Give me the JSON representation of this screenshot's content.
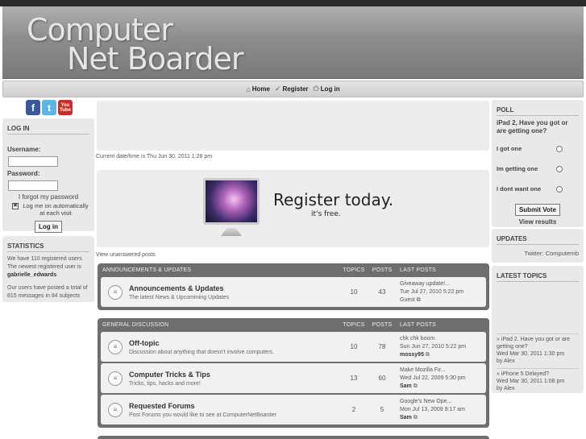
{
  "header": {
    "logo_line1": "Computer",
    "logo_line2": "Net Boarder"
  },
  "nav": {
    "home": "Home",
    "register": "Register",
    "login": "Log in"
  },
  "social": {
    "facebook": "f",
    "twitter": "t",
    "youtube": "You Tube"
  },
  "login_panel": {
    "title": "LOG IN",
    "username_label": "Username:",
    "password_label": "Password:",
    "forgot": "I forgot my password",
    "remember": "Log me on automatically at each visit",
    "remember_check": "✖",
    "button": "Log in"
  },
  "stats_panel": {
    "title": "STATISTICS",
    "registered": "We have 110 registered users",
    "newest_prefix": "The newest registered user is",
    "newest_user": "gabrielle_edwards",
    "posts": "Our users have posted a total of 815 messages in 84 subjects"
  },
  "main": {
    "datetime": "Current date/time is Thu Jun 30, 2011 1:28 pm",
    "register_big": "Register today.",
    "register_small": "it's free.",
    "unanswered": "View unanswered posts"
  },
  "columns": {
    "topics": "TOPICS",
    "posts": "POSTS",
    "last_posts": "LAST POSTS"
  },
  "categories": [
    {
      "name": "ANNOUNCEMENTS & UPDATES",
      "forums": [
        {
          "name": "Announcements & Updates",
          "desc": "The latest News & Upcomming Updates",
          "topics": "10",
          "posts": "43",
          "last_title": "Giveaway update!...",
          "last_date": "Tue Jul 27, 2010 5:22 pm",
          "last_user": "Guest"
        }
      ]
    },
    {
      "name": "GENERAL DISCUSSION",
      "forums": [
        {
          "name": "Off-topic",
          "desc": "Discussion about anything that doesn't involve computers.",
          "topics": "10",
          "posts": "78",
          "last_title": "chk chk boom.",
          "last_date": "Sun Jun 27, 2010 5:22 pm",
          "last_user": "mossy95"
        },
        {
          "name": "Computer Tricks & Tips",
          "desc": "Tricks, tips, hacks and more!",
          "topics": "13",
          "posts": "60",
          "last_title": "Make Mozilla Fir...",
          "last_date": "Wed Jul 22, 2009 5:30 pm",
          "last_user": "Sam"
        },
        {
          "name": "Requested Forums",
          "desc": "Post Forums you would like to see at ComputerNetBoarder",
          "topics": "2",
          "posts": "5",
          "last_title": "Google's New Ope...",
          "last_date": "Mon Jul 13, 2009 9:17 am",
          "last_user": "Sam"
        }
      ]
    }
  ],
  "poll": {
    "title": "POLL",
    "question": "iPad 2, Have you got or are getting one?",
    "options": [
      "I got one",
      "Im getting one",
      "I dont want one"
    ],
    "submit": "Submit Vote",
    "view_results": "View results"
  },
  "updates": {
    "title": "UPDATES",
    "twitter": "Twitter: Computernb"
  },
  "latest_topics": {
    "title": "LATEST TOPICS",
    "items": [
      {
        "title": "» iPad 2. Have you got or are getting one?",
        "date": "Wed Mar 30, 2011 1:30 pm",
        "by": "by Alex"
      },
      {
        "title": "» iPhone 5 Delayed?",
        "date": "Wed Mar 30, 2011 1:08 pm",
        "by": "by Alex"
      }
    ]
  }
}
